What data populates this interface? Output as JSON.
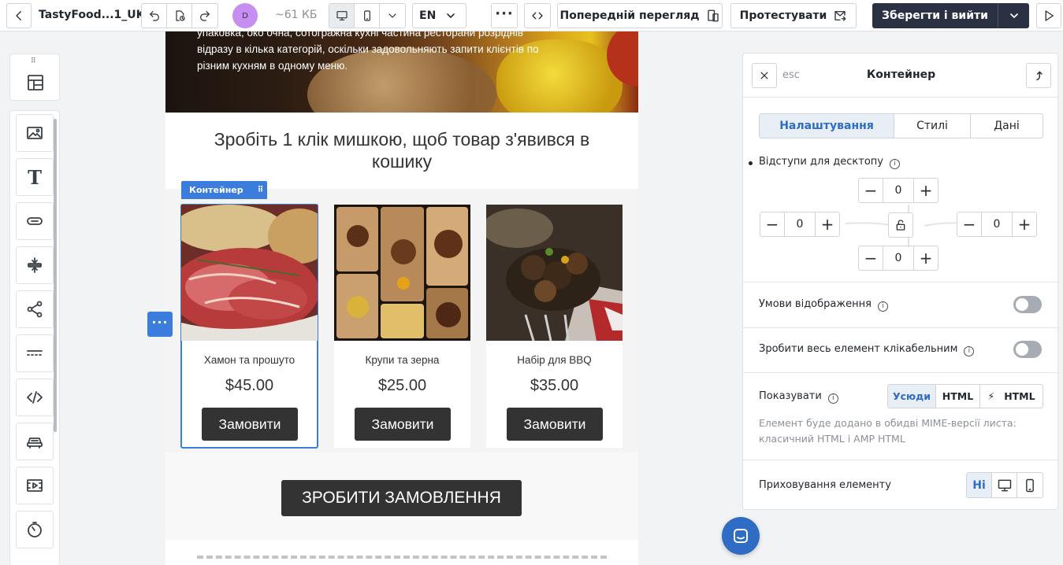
{
  "topbar": {
    "title": "TastyFood...1_UK",
    "avatar_initial": "D",
    "size": "~61 КБ",
    "language": "EN",
    "preview_label": "Попередній перегляд",
    "test_label": "Протестувати",
    "save_label": "Зберегти і вийти"
  },
  "canvas": {
    "hero_lines": [
      "упаковка, око очна, сотогражна кухні частина ресторани розріднів",
      "відразу в кілька категорій, оскільки задовольняють запити клієнтів по",
      "різним кухням в одному меню."
    ],
    "headline": "Зробіть 1 клік мишкою, щоб товар з'явився в кошику",
    "container_label": "Контейнер",
    "products": [
      {
        "name": "Хамон та прошуто",
        "price": "$45.00",
        "button": "Замовити"
      },
      {
        "name": "Крупи та зерна",
        "price": "$25.00",
        "button": "Замовити"
      },
      {
        "name": "Набір для BBQ",
        "price": "$35.00",
        "button": "Замовити"
      }
    ],
    "order_button": "ЗРОБИТИ ЗАМОВЛЕННЯ"
  },
  "panel": {
    "esc": "esc",
    "title": "Контейнер",
    "tabs": [
      "Налаштування",
      "Стилі",
      "Дані"
    ],
    "padding_label": "Відступи для десктопу",
    "padding": {
      "top": "0",
      "left": "0",
      "right": "0",
      "bottom": "0"
    },
    "display_conditions_label": "Умови відображення",
    "clickable_label": "Зробити весь елемент клікабельним",
    "show_label": "Показувати",
    "show_options": [
      "Усюди",
      "HTML",
      "HTML"
    ],
    "show_note": "Елемент буде додано в обидві MIME-версії листа: класичний HTML і AMP HTML",
    "hide_label": "Приховування елементу",
    "hide_none": "Ні"
  },
  "colors": {
    "accent": "#3b7ddd",
    "save_button": "#2a3142",
    "order_button": "#333333"
  }
}
